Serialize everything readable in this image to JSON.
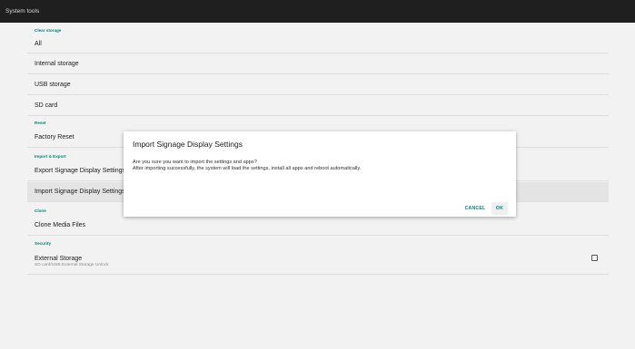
{
  "appbar": {
    "title": "System tools"
  },
  "sections": {
    "clear_storage": "Clear storage",
    "reset": "Reset",
    "import_export": "Import & Export",
    "clone": "Clone",
    "security": "Security"
  },
  "items": {
    "all": "All",
    "internal_storage": "Internal storage",
    "usb_storage": "USB storage",
    "sd_card": "SD card",
    "factory_reset": "Factory Reset",
    "export_settings": "Export Signage Display Settings",
    "import_settings": "Import Signage Display Settings",
    "clone_media": "Clone Media Files",
    "external_storage": "External Storage",
    "external_storage_sub": "SD card/USB External Storage Unlock"
  },
  "external_storage_checked": false,
  "dialog": {
    "title": "Import Signage Display Settings",
    "line1": "Are you sure you want to import the settings and apps?",
    "line2": "After importing successfully, the system will load the settings, install all apps and reboot automatically.",
    "cancel_label": "CANCEL",
    "ok_label": "OK"
  }
}
